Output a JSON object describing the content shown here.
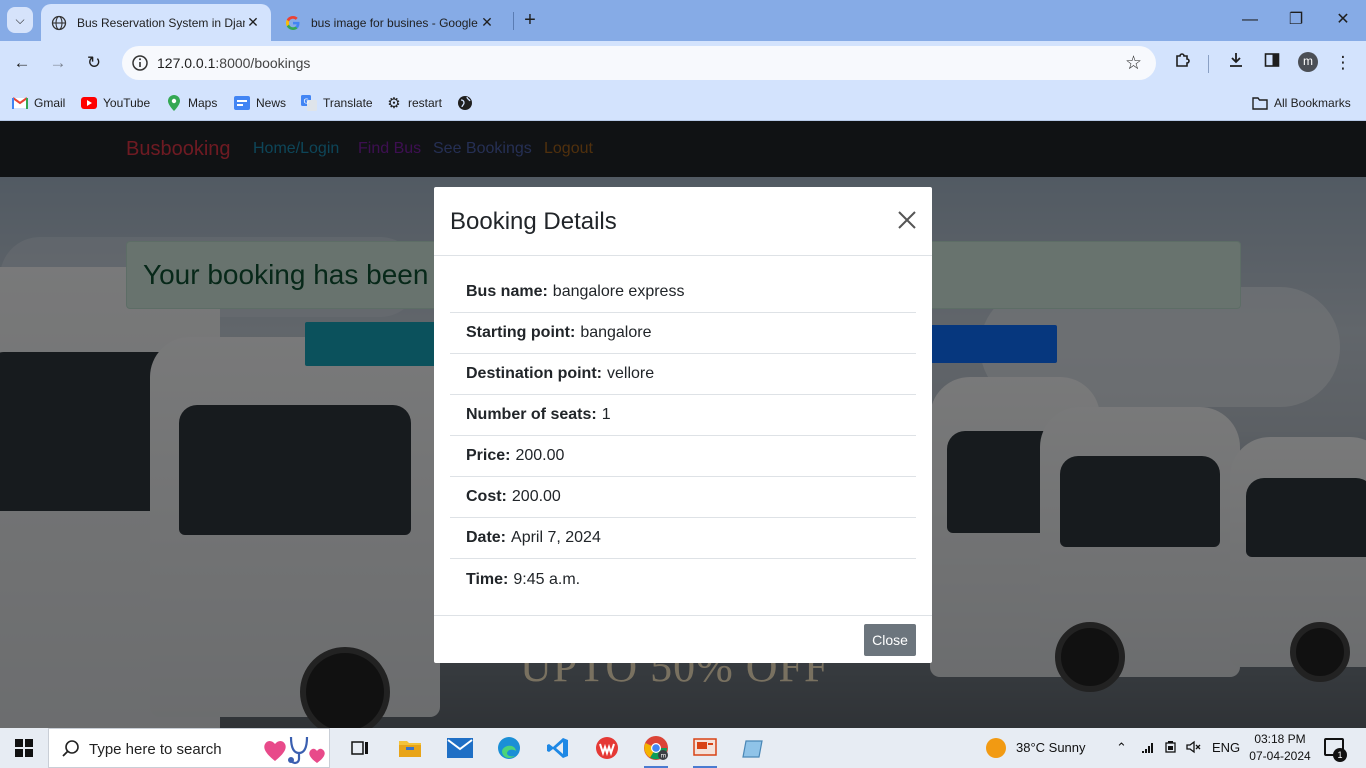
{
  "browser": {
    "tabs": [
      {
        "title": "Bus Reservation System in Djan",
        "active": true
      },
      {
        "title": "bus image for busines - Google",
        "active": false
      }
    ],
    "address": {
      "host": "127.0.0.1",
      "path": ":8000/bookings"
    },
    "bookmarks": [
      {
        "label": "Gmail",
        "icon": "gmail-icon"
      },
      {
        "label": "YouTube",
        "icon": "youtube-icon"
      },
      {
        "label": "Maps",
        "icon": "maps-icon"
      },
      {
        "label": "News",
        "icon": "news-icon"
      },
      {
        "label": "Translate",
        "icon": "translate-icon"
      },
      {
        "label": "restart",
        "icon": "gear-icon"
      },
      {
        "label": "",
        "icon": "globe-icon"
      }
    ],
    "all_bookmarks": "All Bookmarks",
    "profile_initial": "m"
  },
  "site": {
    "brand": "Busbooking",
    "nav": [
      {
        "label": "Home/Login",
        "color": "#1a8bb0"
      },
      {
        "label": "Find Bus",
        "color": "#7a1fa2"
      },
      {
        "label": "See Bookings",
        "color": "#4b5fa8"
      },
      {
        "label": "Logout",
        "color": "#a0601a"
      }
    ],
    "alert_text": "Your booking has been",
    "offer_text": "UPTO 50% OFF"
  },
  "modal": {
    "title": "Booking Details",
    "fields": [
      {
        "label": "Bus name:",
        "value": "bangalore express"
      },
      {
        "label": "Starting point:",
        "value": "bangalore"
      },
      {
        "label": "Destination point:",
        "value": "vellore"
      },
      {
        "label": "Number of seats:",
        "value": "1"
      },
      {
        "label": "Price:",
        "value": "200.00"
      },
      {
        "label": "Cost:",
        "value": "200.00"
      },
      {
        "label": "Date:",
        "value": "April 7, 2024"
      },
      {
        "label": "Time:",
        "value": "9:45 a.m."
      }
    ],
    "close_label": "Close"
  },
  "taskbar": {
    "search_placeholder": "Type here to search",
    "weather": "38°C  Sunny",
    "language": "ENG",
    "time": "03:18 PM",
    "date": "07-04-2024",
    "notification_count": "1"
  }
}
